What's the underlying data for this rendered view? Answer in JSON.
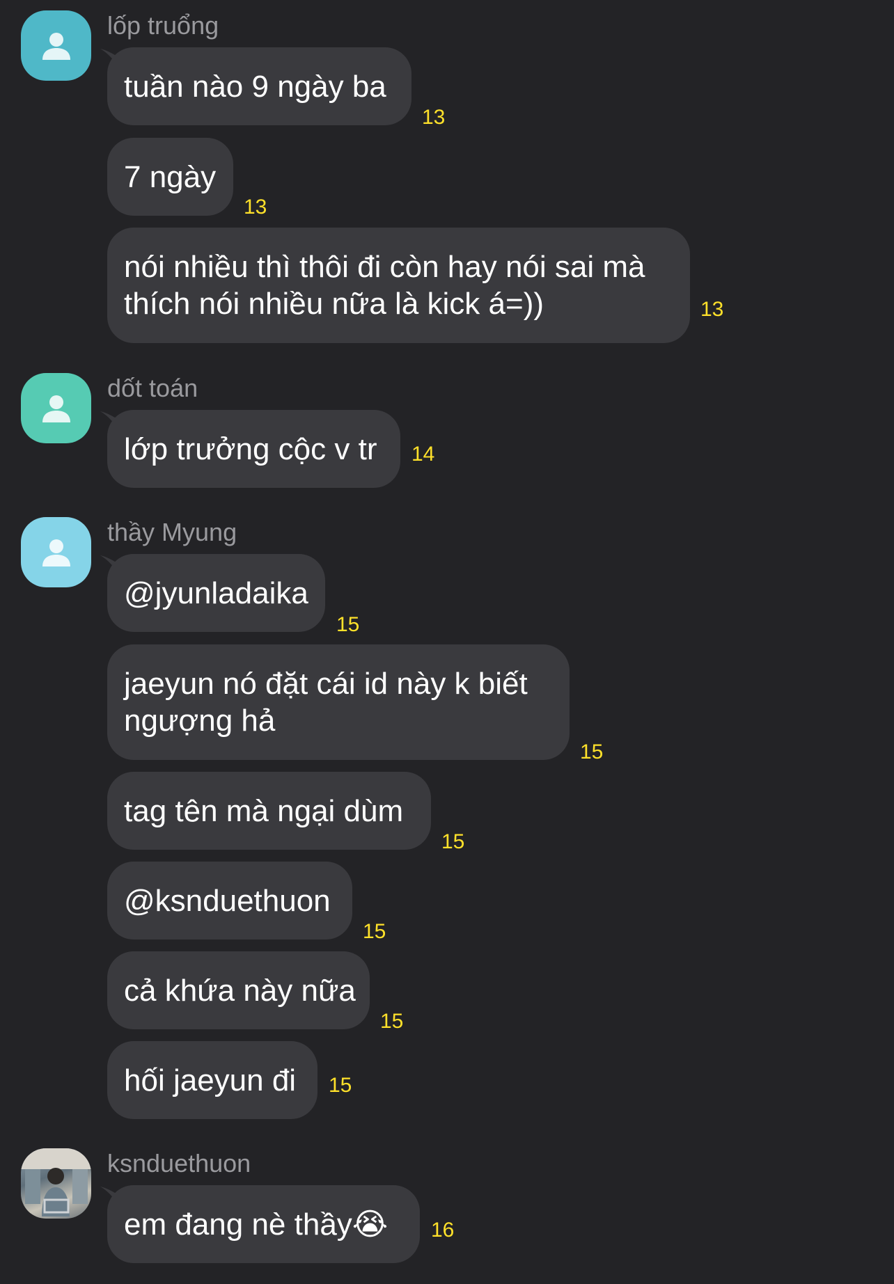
{
  "colors": {
    "background": "#232326",
    "bubble": "#3a3a3e",
    "sender_name": "#9a9a9e",
    "timestamp": "#ffe12a",
    "avatar_teal_1": "#4fb8c8",
    "avatar_teal_2": "#56cbb3",
    "avatar_light_blue": "#85d4e8"
  },
  "groups": [
    {
      "sender": "lốp truổng",
      "avatar_icon": "person-icon",
      "messages": [
        {
          "text": "tuần nào 9 ngày ba",
          "time": "13"
        },
        {
          "text": "7 ngày",
          "time": "13"
        },
        {
          "lines": [
            "nói nhiều thì thôi đi còn hay nói sai mà",
            "thích nói nhiều nữa là kick á=))"
          ],
          "time": "13"
        }
      ]
    },
    {
      "sender": "dốt toán",
      "avatar_icon": "person-icon",
      "messages": [
        {
          "text": "lớp trưởng cộc v tr",
          "time": "14"
        }
      ]
    },
    {
      "sender": "thầy Myung",
      "avatar_icon": "person-icon",
      "messages": [
        {
          "text": "@jyunladaika",
          "time": "15"
        },
        {
          "lines": [
            "jaeyun nó đặt cái id này k biết",
            "ngượng hả"
          ],
          "time": "15"
        },
        {
          "text": "tag tên mà ngại dùm",
          "time": "15"
        },
        {
          "text": "@ksnduethuon",
          "time": "15"
        },
        {
          "text": "cả khứa này nữa",
          "time": "15"
        },
        {
          "text": "hối jaeyun đi",
          "time": "15"
        }
      ]
    },
    {
      "sender": "ksnduethuon",
      "avatar_icon": "photo-avatar",
      "messages": [
        {
          "text": "em đang nè thầy",
          "emoji": "😭",
          "time": "16"
        }
      ]
    }
  ]
}
